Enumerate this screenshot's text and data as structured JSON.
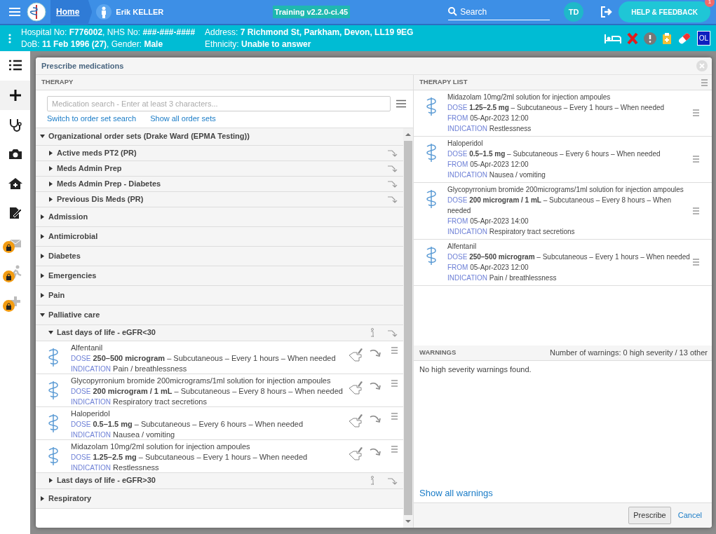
{
  "topbar": {
    "home": "Home",
    "patient": "Erik KELLER",
    "environment": "Training v2.2.0-ci.45",
    "search": "Search",
    "avatar": "TD",
    "help": "HELP & FEEDBACK",
    "help_badge": "1"
  },
  "banner": {
    "left": [
      "Hospital No: **F776002**, NHS No: **###-###-####**",
      "DoB: **11 Feb 1996 (27)**, Gender: **Male**"
    ],
    "right": [
      "Address: **7 Richmond St, Parkham, Devon, LL19 9EG**",
      "Ethnicity: **Unable to answer**"
    ],
    "badge": "OL"
  },
  "sidebar": {
    "items": [
      {
        "selected": false,
        "locked": false
      },
      {
        "selected": true,
        "locked": false
      },
      {
        "selected": false,
        "locked": false
      },
      {
        "selected": false,
        "locked": false
      },
      {
        "selected": false,
        "locked": false
      },
      {
        "selected": false,
        "locked": false
      },
      {
        "selected": false,
        "locked": true
      },
      {
        "selected": false,
        "locked": true
      },
      {
        "selected": false,
        "locked": true
      }
    ]
  },
  "modal": {
    "title": "Prescribe medications",
    "therapy": {
      "header": "THERAPY",
      "search": {
        "placeholder": "Medication search - Enter at least 3 characters..."
      },
      "links": [
        "Switch to order set search",
        "Show all order sets"
      ],
      "tree": [
        {
          "kind": "group",
          "label": "Organizational order sets (Drake Ward (EPMA Testing))",
          "expanded": true,
          "children": [
            {
              "kind": "order_set",
              "label": "Active meds PT2 (PR)",
              "expanded": false,
              "info": false
            },
            {
              "kind": "order_set",
              "label": "Meds Admin Prep",
              "expanded": false,
              "info": false
            },
            {
              "kind": "order_set",
              "label": "Meds Admin Prep - Diabetes",
              "expanded": false,
              "info": false
            },
            {
              "kind": "order_set",
              "label": "Previous Dis Meds (PR)",
              "expanded": false,
              "info": false
            }
          ]
        },
        {
          "kind": "group",
          "label": "Admission",
          "expanded": false
        },
        {
          "kind": "group",
          "label": "Antimicrobial",
          "expanded": false
        },
        {
          "kind": "group",
          "label": "Diabetes",
          "expanded": false
        },
        {
          "kind": "group",
          "label": "Emergencies",
          "expanded": false
        },
        {
          "kind": "group",
          "label": "Pain",
          "expanded": false
        },
        {
          "kind": "group",
          "label": "Palliative care",
          "expanded": true,
          "children": [
            {
              "kind": "order_set",
              "label": "Last days of life - eGFR<30",
              "expanded": true,
              "info": true,
              "children": [
                {
                  "kind": "medication",
                  "name": "Alfentanil",
                  "dose_label": "DOSE",
                  "dose": "**250–500 microgram** – Subcutaneous – Every 1 hours – When needed",
                  "indication_label": "INDICATION",
                  "indication": "Pain / breathlessness"
                },
                {
                  "kind": "medication",
                  "name": "Glycopyrronium bromide 200micrograms/1ml solution for injection ampoules",
                  "dose_label": "DOSE",
                  "dose": "**200 microgram / 1 mL** – Subcutaneous – Every 8 hours – When needed",
                  "indication_label": "INDICATION",
                  "indication": "Respiratory tract secretions"
                },
                {
                  "kind": "medication",
                  "name": "Haloperidol",
                  "dose_label": "DOSE",
                  "dose": "**0.5–1.5 mg** – Subcutaneous – Every 6 hours – When needed",
                  "indication_label": "INDICATION",
                  "indication": "Nausea / vomiting"
                },
                {
                  "kind": "medication",
                  "name": "Midazolam 10mg/2ml solution for injection ampoules",
                  "dose_label": "DOSE",
                  "dose": "**1.25–2.5 mg** – Subcutaneous – Every 1 hours – When needed",
                  "indication_label": "INDICATION",
                  "indication": "Restlessness"
                }
              ]
            },
            {
              "kind": "order_set",
              "label": "Last days of life - eGFR>30",
              "expanded": false,
              "info": true
            }
          ]
        },
        {
          "kind": "group",
          "label": "Respiratory",
          "expanded": false
        }
      ]
    },
    "therapy_list": {
      "header": "THERAPY LIST",
      "items": [
        {
          "name": "Midazolam 10mg/2ml solution for injection ampoules",
          "dose_label": "DOSE",
          "dose": "**1.25–2.5 mg** – Subcutaneous – Every 1 hours – When needed",
          "from_label": "FROM",
          "from": "05-Apr-2023 12:00",
          "indication_label": "INDICATION",
          "indication": "Restlessness"
        },
        {
          "name": "Haloperidol",
          "dose_label": "DOSE",
          "dose": "**0.5–1.5 mg** – Subcutaneous – Every 6 hours – When needed",
          "from_label": "FROM",
          "from": "05-Apr-2023 12:00",
          "indication_label": "INDICATION",
          "indication": "Nausea / vomiting"
        },
        {
          "name": "Glycopyrronium bromide 200micrograms/1ml solution for injection ampoules",
          "dose_label": "DOSE",
          "dose": "**200 microgram / 1 mL** – Subcutaneous – Every 8 hours – When needed",
          "from_label": "FROM",
          "from": "05-Apr-2023 14:00",
          "indication_label": "INDICATION",
          "indication": "Respiratory tract secretions"
        },
        {
          "name": "Alfentanil",
          "dose_label": "DOSE",
          "dose": "**250–500 microgram** – Subcutaneous – Every 1 hours – When needed",
          "from_label": "FROM",
          "from": "05-Apr-2023 12:00",
          "indication_label": "INDICATION",
          "indication": "Pain / breathlessness"
        }
      ]
    },
    "warnings": {
      "header": "WARNINGS",
      "count": "Number of warnings: 0 high severity / 13 other",
      "message": "No high severity warnings found.",
      "link": "Show all warnings"
    },
    "buttons": {
      "prescribe": "Prescribe",
      "cancel": "Cancel"
    }
  }
}
